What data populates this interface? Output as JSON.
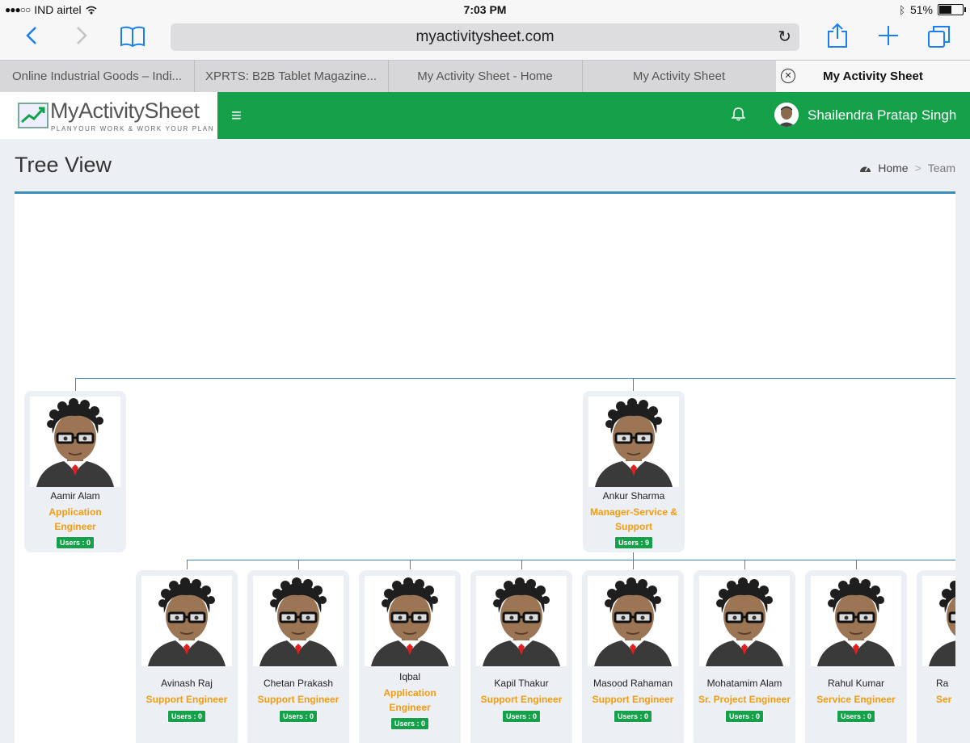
{
  "status_bar": {
    "carrier": "IND airtel",
    "time": "7:03 PM",
    "battery": "51%"
  },
  "browser": {
    "url": "myactivitysheet.com",
    "tabs": [
      {
        "label": "Online Industrial Goods – Indi..."
      },
      {
        "label": "XPRTS: B2B Tablet Magazine..."
      },
      {
        "label": "My Activity Sheet - Home"
      },
      {
        "label": "My Activity Sheet"
      },
      {
        "label": "My Activity Sheet"
      }
    ]
  },
  "app": {
    "logo_title": "MyActivitySheet",
    "logo_tagline": "PLANYOUR WORK & WORK YOUR PLAN",
    "user_name": "Shailendra Pratap Singh"
  },
  "page": {
    "title": "Tree View",
    "breadcrumb": [
      {
        "label": "Home"
      },
      {
        "label": "Team"
      }
    ]
  },
  "tree": {
    "level1": [
      {
        "name": "Aamir Alam",
        "role": "Application Engineer",
        "users": "Users : 0"
      },
      {
        "name": "Ankur Sharma",
        "role": "Manager-Service & Support",
        "users": "Users : 9"
      }
    ],
    "level2": [
      {
        "name": "Avinash Raj",
        "role": "Support Engineer",
        "users": "Users : 0"
      },
      {
        "name": "Chetan Prakash",
        "role": "Support Engineer",
        "users": "Users : 0"
      },
      {
        "name": "Iqbal",
        "role": "Application Engineer",
        "users": "Users : 0"
      },
      {
        "name": "Kapil Thakur",
        "role": "Support Engineer",
        "users": "Users : 0"
      },
      {
        "name": "Masood Rahaman",
        "role": "Support Engineer",
        "users": "Users : 0"
      },
      {
        "name": "Mohatamim Alam",
        "role": "Sr. Project Engineer",
        "users": "Users : 0"
      },
      {
        "name": "Rahul Kumar",
        "role": "Service Engineer",
        "users": "Users : 0"
      },
      {
        "name": "Ra",
        "role": "Ser",
        "users": ""
      }
    ]
  },
  "colors": {
    "brand_green": "#14a14a",
    "role_orange": "#f39c12",
    "accent_blue": "#3c8dbc"
  },
  "icons": [
    "back-icon",
    "forward-icon",
    "bookmarks-icon",
    "reload-icon",
    "share-icon",
    "new-tab-icon",
    "tabs-icon",
    "close-tab-icon",
    "hamburger-icon",
    "bell-icon",
    "dashboard-icon"
  ]
}
